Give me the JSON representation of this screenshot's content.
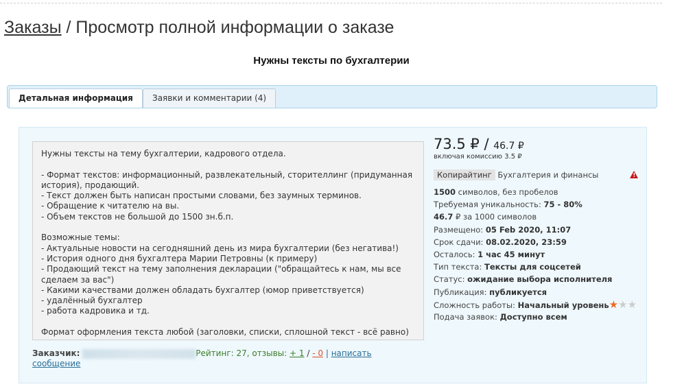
{
  "breadcrumb": {
    "link": "Заказы",
    "separator": " / ",
    "current": "Просмотр полной информации о заказе"
  },
  "order_title": "Нужны тексты по бухгалтерии",
  "tabs": [
    {
      "label": "Детальная информация"
    },
    {
      "label": "Заявки и комментарии (4)"
    }
  ],
  "description": "Нужны тексты на тему бухгалтерии, кадрового отдела.\n\n- Формат текстов: информационный, развлекательный, сторителлинг (придуманная история), продающий.\n- Текст должен быть написан простыми словами, без заумных терминов.\n- Обращение к читателю на вы.\n- Объем текстов не большой до 1500 зн.б.п.\n\nВозможные темы:\n- Актуальные новости на сегодняшний день из мира бухгалтерии (без негатива!)\n- История одного дня бухгалтера Марии Петровны (к примеру)\n- Продающий текст на тему заполнения декларации (\"обращайтесь к нам, мы все сделаем за вас\")\n- Какими качествами должен обладать бухгалтер (юмор приветствуется)\n- удалённый бухгалтер\n- работа кадровика и тд.\n\nФормат оформления текста любой (заголовки, списки, сплошной текст - всё равно)",
  "customer": {
    "label": "Заказчик:",
    "rating": "Рейтинг: 27, отзывы:",
    "plus": "+ 1",
    "slash": "/",
    "minus": "- 0",
    "sep": "|",
    "message": "написать сообщение"
  },
  "price": {
    "total": "73.5 ₽ /",
    "net": "46.7 ₽",
    "commission": "включая комиссию 3.5 ₽"
  },
  "category": {
    "tag": "Копирайтинг",
    "name": "Бухгалтерия и финансы",
    "warning_icon": "!"
  },
  "details": {
    "chars_value": "1500",
    "chars_text": "символов, без пробелов",
    "uniq_label": "Требуемая уникальность:",
    "uniq_value": "75 - 80%",
    "rate_value": "46.7",
    "rate_text": "₽ за 1000 символов",
    "posted_label": "Размещено:",
    "posted_value": "05 Feb 2020, 11:07",
    "deadline_label": "Срок сдачи:",
    "deadline_value": "08.02.2020, 23:59",
    "left_label": "Осталось:",
    "left_value": "1 час 45 минут",
    "type_label": "Тип текста:",
    "type_value": "Тексты для соцсетей",
    "status_label": "Статус:",
    "status_value": "ожидание выбора исполнителя",
    "pub_label": "Публикация:",
    "pub_value": "публикуется",
    "difficulty_label": "Сложность работы:",
    "difficulty_value": "Начальный уровень",
    "difficulty_stars": 1,
    "difficulty_max": 3,
    "apply_label": "Подача заявок:",
    "apply_value": "Доступно всем"
  },
  "colors": {
    "accent_red": "#e0502a",
    "link_green": "#3b7d2a",
    "link_blue": "#2a6f98",
    "star": "#ee6a22"
  }
}
